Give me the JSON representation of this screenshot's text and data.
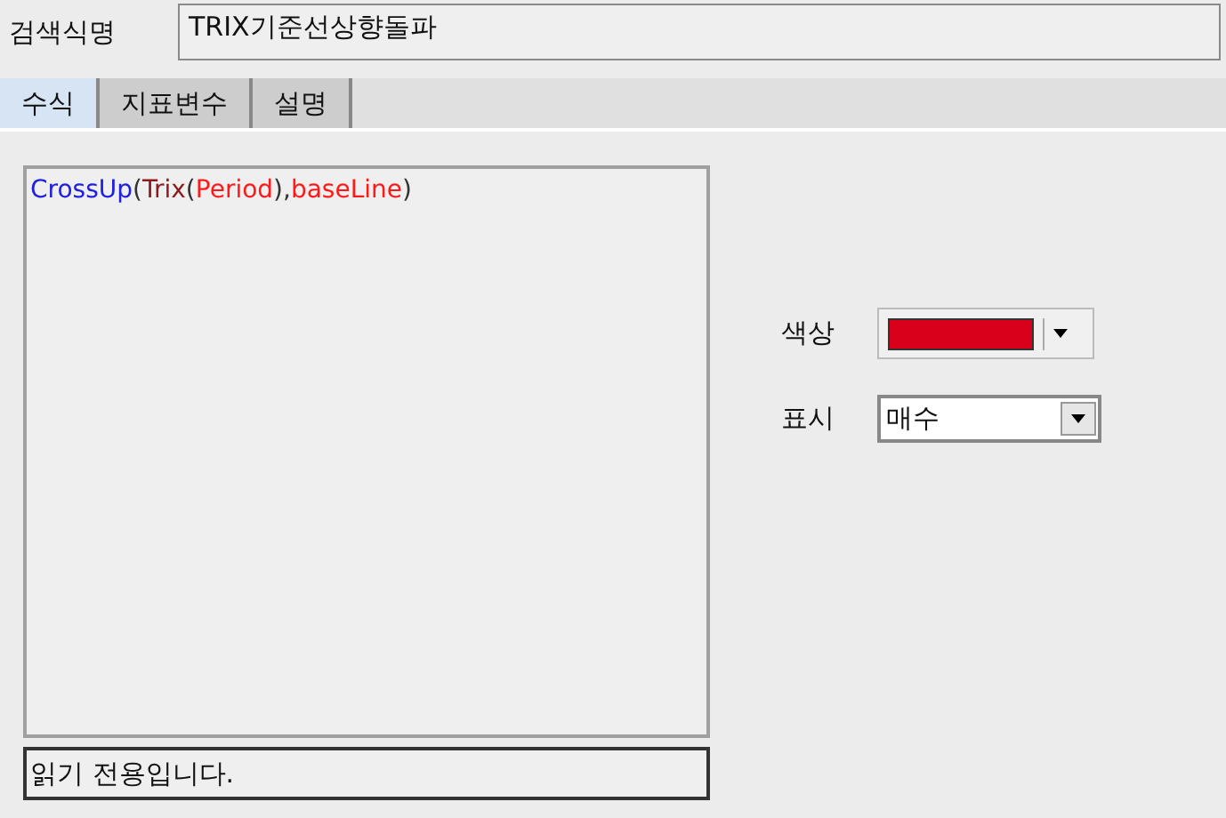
{
  "name_field": {
    "label": "검색식명",
    "value": "TRIX기준선상향돌파"
  },
  "tabs": [
    {
      "label": "수식",
      "selected": true
    },
    {
      "label": "지표변수",
      "selected": false
    },
    {
      "label": "설명",
      "selected": false
    }
  ],
  "formula": [
    {
      "text": "CrossUp",
      "kind": "function"
    },
    {
      "text": "(",
      "kind": "punct"
    },
    {
      "text": "Trix",
      "kind": "indicator"
    },
    {
      "text": "(",
      "kind": "punct"
    },
    {
      "text": "Period",
      "kind": "variable"
    },
    {
      "text": "),",
      "kind": "punct"
    },
    {
      "text": "baseLine",
      "kind": "variable"
    },
    {
      "text": ")",
      "kind": "punct"
    }
  ],
  "status": "읽기 전용입니다.",
  "color_field": {
    "label": "색상",
    "color": "#d9001b"
  },
  "display_field": {
    "label": "표시",
    "value": "매수"
  }
}
